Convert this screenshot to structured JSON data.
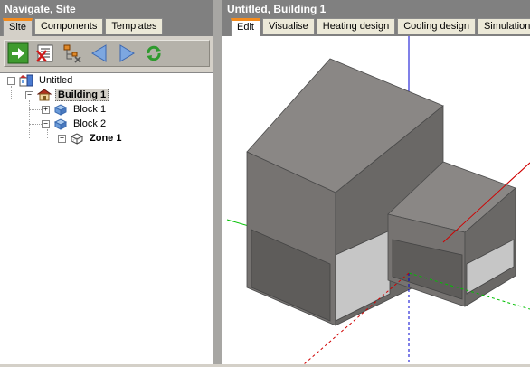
{
  "left": {
    "header": "Navigate, Site",
    "tabs": [
      {
        "label": "Site",
        "active": true
      },
      {
        "label": "Components",
        "active": false
      },
      {
        "label": "Templates",
        "active": false
      }
    ],
    "toolbar": [
      {
        "icon": "go-arrow-icon"
      },
      {
        "icon": "delete-list-icon"
      },
      {
        "icon": "tree-delete-icon"
      },
      {
        "icon": "back-arrow-icon"
      },
      {
        "icon": "forward-arrow-icon"
      },
      {
        "icon": "refresh-icon"
      }
    ],
    "tree": {
      "site": "Untitled",
      "building": "Building 1",
      "block1": "Block 1",
      "block2": "Block 2",
      "zone1": "Zone 1"
    }
  },
  "right": {
    "header": "Untitled, Building 1",
    "tabs": [
      {
        "label": "Edit",
        "active": true
      },
      {
        "label": "Visualise",
        "active": false
      },
      {
        "label": "Heating design",
        "active": false
      },
      {
        "label": "Cooling design",
        "active": false
      },
      {
        "label": "Simulation",
        "active": false
      }
    ]
  },
  "colors": {
    "tab_accent": "#f38b1d",
    "x_axis": "#d00000",
    "y_axis": "#00c000",
    "z_axis": "#0000d0"
  }
}
